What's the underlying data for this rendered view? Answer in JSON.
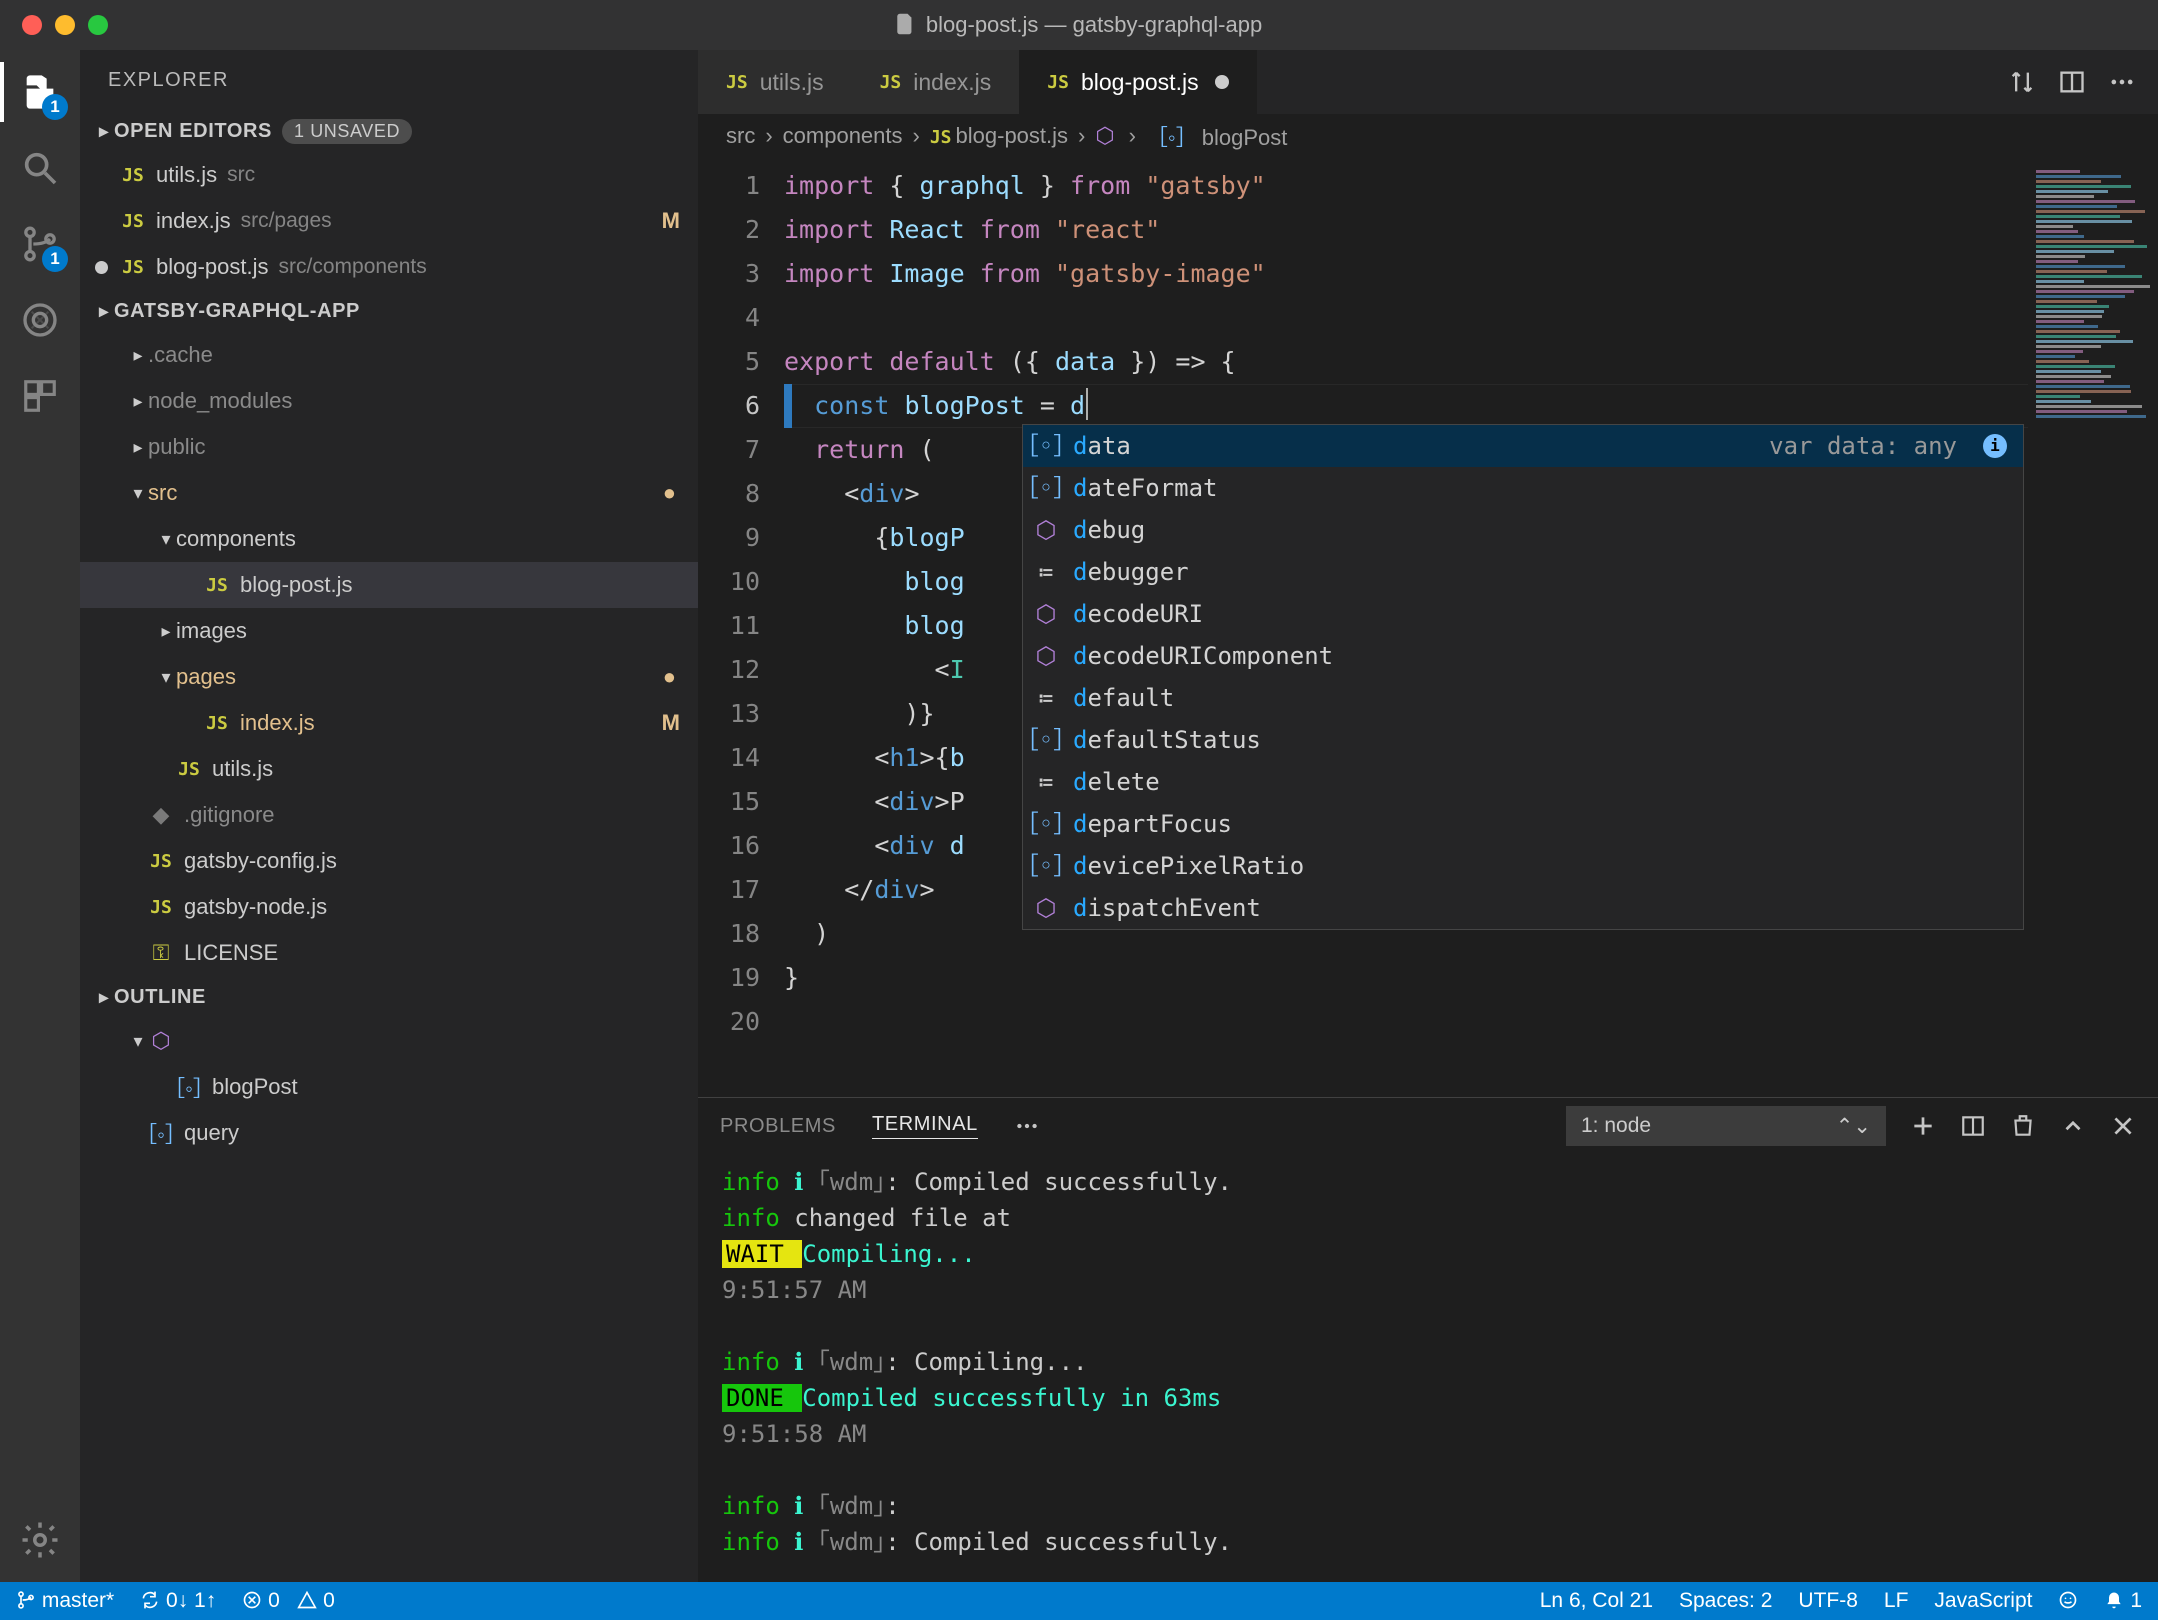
{
  "window": {
    "title": "blog-post.js — gatsby-graphql-app"
  },
  "activity": {
    "explorer_badge": "1",
    "scm_badge": "1"
  },
  "sidebar": {
    "title": "EXPLORER",
    "open_editors_label": "OPEN EDITORS",
    "unsaved_badge": "1 UNSAVED",
    "open_editors": [
      {
        "name": "utils.js",
        "dir": "src",
        "status": ""
      },
      {
        "name": "index.js",
        "dir": "src/pages",
        "status": "M"
      },
      {
        "name": "blog-post.js",
        "dir": "src/components",
        "status": "",
        "dirty": true
      }
    ],
    "workspace_label": "GATSBY-GRAPHQL-APP",
    "tree": [
      {
        "depth": 1,
        "chev": "right",
        "name": ".cache",
        "dim": true
      },
      {
        "depth": 1,
        "chev": "right",
        "name": "node_modules",
        "dim": true
      },
      {
        "depth": 1,
        "chev": "right",
        "name": "public",
        "dim": true
      },
      {
        "depth": 1,
        "chev": "down",
        "name": "src",
        "gold": true,
        "dot": true
      },
      {
        "depth": 2,
        "chev": "down",
        "name": "components"
      },
      {
        "depth": 3,
        "file": "js",
        "name": "blog-post.js",
        "selected": true
      },
      {
        "depth": 2,
        "chev": "right",
        "name": "images"
      },
      {
        "depth": 2,
        "chev": "down",
        "name": "pages",
        "gold": true,
        "dot": true
      },
      {
        "depth": 3,
        "file": "js",
        "name": "index.js",
        "gold": true,
        "status": "M"
      },
      {
        "depth": 2,
        "file": "js",
        "name": "utils.js"
      },
      {
        "depth": 1,
        "file": "git",
        "name": ".gitignore",
        "dim": true
      },
      {
        "depth": 1,
        "file": "js",
        "name": "gatsby-config.js"
      },
      {
        "depth": 1,
        "file": "js",
        "name": "gatsby-node.js"
      },
      {
        "depth": 1,
        "file": "lic",
        "name": "LICENSE"
      }
    ],
    "outline_label": "OUTLINE",
    "outline": [
      {
        "depth": 1,
        "icon": "fn",
        "name": "<function>",
        "chev": "down"
      },
      {
        "depth": 2,
        "icon": "var",
        "name": "blogPost"
      },
      {
        "depth": 1,
        "icon": "var",
        "name": "query"
      }
    ]
  },
  "tabs": [
    {
      "name": "utils.js",
      "active": false
    },
    {
      "name": "index.js",
      "active": false
    },
    {
      "name": "blog-post.js",
      "active": true,
      "dirty": true
    }
  ],
  "breadcrumbs": [
    "src",
    "components",
    "blog-post.js",
    "<function>",
    "blogPost"
  ],
  "code": {
    "lines": [
      {
        "n": 1,
        "html": "<span class='k'>import</span> <span class='pun'>{</span> <span class='id'>graphql</span> <span class='pun'>}</span> <span class='k'>from</span> <span class='str'>\"gatsby\"</span>"
      },
      {
        "n": 2,
        "html": "<span class='k'>import</span> <span class='id'>React</span> <span class='k'>from</span> <span class='str'>\"react\"</span>"
      },
      {
        "n": 3,
        "html": "<span class='k'>import</span> <span class='id'>Image</span> <span class='k'>from</span> <span class='str'>\"gatsby-image\"</span>"
      },
      {
        "n": 4,
        "html": ""
      },
      {
        "n": 5,
        "html": "<span class='k'>export</span> <span class='k'>default</span> <span class='pun'>({</span> <span class='id'>data</span> <span class='pun'>}) =&gt; {</span>"
      },
      {
        "n": 6,
        "html": "  <span class='def'>const</span> <span class='id'>blogPost</span> <span class='pun'>=</span> <span class='id'>d</span><span class='cursor'></span>",
        "current": true
      },
      {
        "n": 7,
        "html": "  <span class='k'>return</span> <span class='pun'>(</span>"
      },
      {
        "n": 8,
        "html": "    <span class='pun'>&lt;</span><span class='tag'>div</span><span class='pun'>&gt;</span>"
      },
      {
        "n": 9,
        "html": "      <span class='pun'>{</span><span class='id'>blogP</span>"
      },
      {
        "n": 10,
        "html": "        <span class='id'>blog</span>"
      },
      {
        "n": 11,
        "html": "        <span class='id'>blog</span>"
      },
      {
        "n": 12,
        "html": "          <span class='pun'>&lt;</span><span class='ty'>I</span>"
      },
      {
        "n": 13,
        "html": "        <span class='pun'>)}</span>"
      },
      {
        "n": 14,
        "html": "      <span class='pun'>&lt;</span><span class='tag'>h1</span><span class='pun'>&gt;{</span><span class='id'>b</span>"
      },
      {
        "n": 15,
        "html": "      <span class='pun'>&lt;</span><span class='tag'>div</span><span class='pun'>&gt;</span><span class='pun'>P</span>"
      },
      {
        "n": 16,
        "html": "      <span class='pun'>&lt;</span><span class='tag'>div</span> <span class='id'>d</span>"
      },
      {
        "n": 17,
        "html": "    <span class='pun'>&lt;/</span><span class='tag'>div</span><span class='pun'>&gt;</span>"
      },
      {
        "n": 18,
        "html": "  <span class='pun'>)</span>"
      },
      {
        "n": 19,
        "html": "<span class='pun'>}</span>"
      },
      {
        "n": 20,
        "html": ""
      }
    ]
  },
  "suggest": {
    "detail": "var data: any",
    "items": [
      {
        "icon": "var",
        "text": "data",
        "selected": true
      },
      {
        "icon": "var",
        "text": "dateFormat"
      },
      {
        "icon": "fn",
        "text": "debug"
      },
      {
        "icon": "kw",
        "text": "debugger"
      },
      {
        "icon": "fn",
        "text": "decodeURI"
      },
      {
        "icon": "fn",
        "text": "decodeURIComponent"
      },
      {
        "icon": "kw",
        "text": "default"
      },
      {
        "icon": "var",
        "text": "defaultStatus"
      },
      {
        "icon": "kw",
        "text": "delete"
      },
      {
        "icon": "var",
        "text": "departFocus"
      },
      {
        "icon": "var",
        "text": "devicePixelRatio"
      },
      {
        "icon": "fn",
        "text": "dispatchEvent"
      }
    ]
  },
  "panel": {
    "tabs": {
      "problems": "PROBLEMS",
      "terminal": "TERMINAL"
    },
    "selector": "1: node",
    "terminal_lines": [
      {
        "html": "<span class='t-green'>info</span> <span class='t-cyan'>ℹ</span> <span class='t-dim'>｢wdm｣</span>: Compiled successfully."
      },
      {
        "html": "<span class='t-green'>info</span> changed file at"
      },
      {
        "html": "<span class='t-wait'> WAIT </span>  <span class='t-cyan'>Compiling...</span>"
      },
      {
        "html": "<span class='t-dim'>9:51:57 AM</span>"
      },
      {
        "html": ""
      },
      {
        "html": "<span class='t-green'>info</span> <span class='t-cyan'>ℹ</span> <span class='t-dim'>｢wdm｣</span>: Compiling..."
      },
      {
        "html": "<span class='t-done'> DONE </span>  <span class='t-cyan'>Compiled successfully in 63ms</span>"
      },
      {
        "html": "<span class='t-dim'>9:51:58 AM</span>"
      },
      {
        "html": ""
      },
      {
        "html": "<span class='t-green'>info</span> <span class='t-cyan'>ℹ</span> <span class='t-dim'>｢wdm｣</span>:"
      },
      {
        "html": "<span class='t-green'>info</span> <span class='t-cyan'>ℹ</span> <span class='t-dim'>｢wdm｣</span>: Compiled successfully."
      }
    ]
  },
  "status": {
    "branch": "master*",
    "sync": "0↓ 1↑",
    "errors": "0",
    "warnings": "0",
    "cursor": "Ln 6, Col 21",
    "spaces": "Spaces: 2",
    "encoding": "UTF-8",
    "eol": "LF",
    "lang": "JavaScript",
    "bell": "1"
  }
}
